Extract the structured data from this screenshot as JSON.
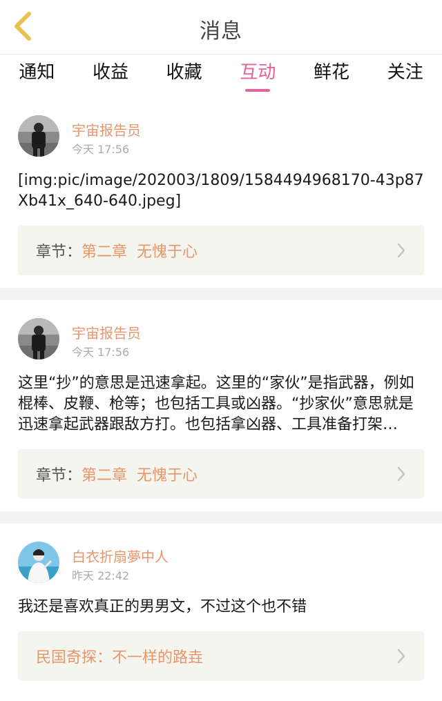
{
  "header": {
    "title": "消息"
  },
  "tabs": [
    {
      "label": "通知"
    },
    {
      "label": "收益"
    },
    {
      "label": "收藏"
    },
    {
      "label": "互动"
    },
    {
      "label": "鲜花"
    },
    {
      "label": "关注"
    }
  ],
  "active_tab": "互动",
  "messages": [
    {
      "user": "宇宙报告员",
      "time": "今天 17:56",
      "content": "[img:pic/image/202003/1809/1584494968170-43p87Xb41x_640-640.jpeg]",
      "ref_label": "章节：",
      "ref_value": "第二章  无愧于心"
    },
    {
      "user": "宇宙报告员",
      "time": "今天 17:56",
      "content": "这里“抄”的意思是迅速拿起。这里的“家伙”是指武器，例如棍棒、皮鞭、枪等；也包括工具或凶器。“抄家伙”意思就是迅速拿起武器跟敌方打。也包括拿凶器、工具准备打架…",
      "ref_label": "章节：",
      "ref_value": "第二章  无愧于心"
    },
    {
      "user": "白衣折扇夢中人",
      "time": "昨天 22:42",
      "content": "我还是喜欢真正的男男文，不过这个也不错",
      "ref_book": "民国奇探：不一样的路垚"
    }
  ],
  "colors": {
    "accent": "#e8619a",
    "name": "#e8956a",
    "back_icon": "#e8c24a"
  }
}
